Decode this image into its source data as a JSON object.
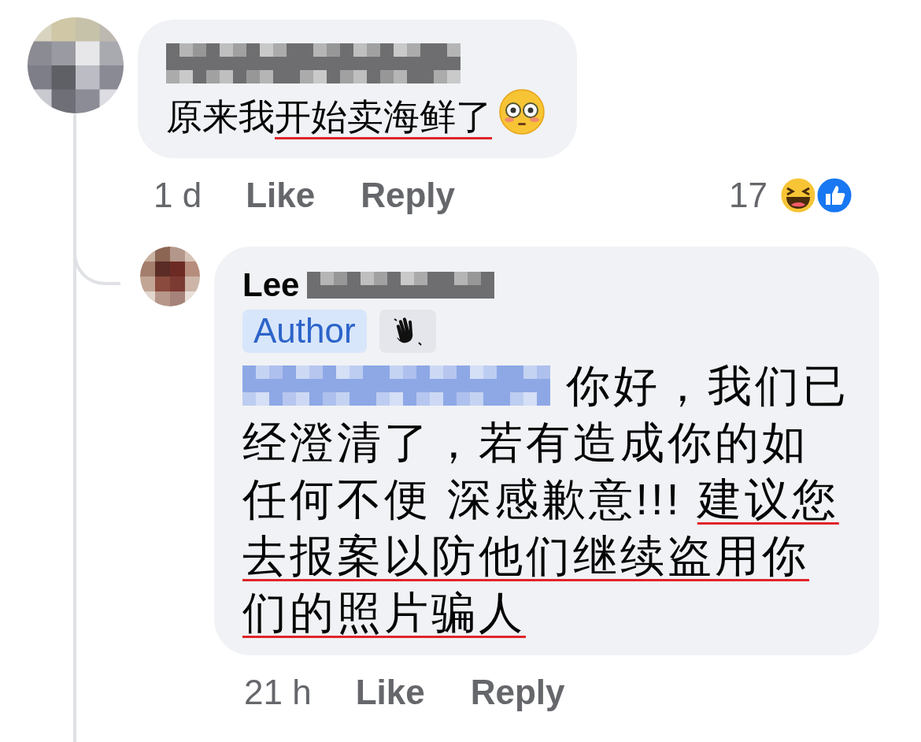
{
  "comments": [
    {
      "name_parts": [
        {
          "kind": "hidden",
          "color": "#6e6e70"
        }
      ],
      "body": [
        {
          "kind": "text",
          "text": "原来我",
          "underlined": false
        },
        {
          "kind": "text",
          "text": "开始卖海鲜了",
          "underlined": true
        },
        {
          "kind": "emoji"
        }
      ],
      "time": "1 d",
      "actions": [
        "Like",
        "Reply"
      ],
      "reaction_count": "17",
      "reactions": [
        {
          "kind": "haha"
        },
        {
          "kind": "like"
        }
      ],
      "replies": [
        {
          "name_parts": [
            {
              "kind": "text",
              "text": "Lee"
            },
            {
              "kind": "hidden",
              "color": "#6e6e70"
            }
          ],
          "badges": [
            {
              "kind": "label",
              "text": "Author"
            },
            {
              "kind": "wave"
            }
          ],
          "body": [
            {
              "kind": "hidden",
              "color": "#8ea8e6"
            },
            {
              "kind": "text",
              "text": " 你好，我们已经澄清了，若有造成你的如任何不便 深感歉意!!! ",
              "underlined": false
            },
            {
              "kind": "text",
              "text": "建议您去报案以防他们继续盗用你们的照片骗人",
              "underlined": true
            }
          ],
          "time": "21 h",
          "actions": [
            "Like",
            "Reply"
          ]
        }
      ]
    }
  ]
}
